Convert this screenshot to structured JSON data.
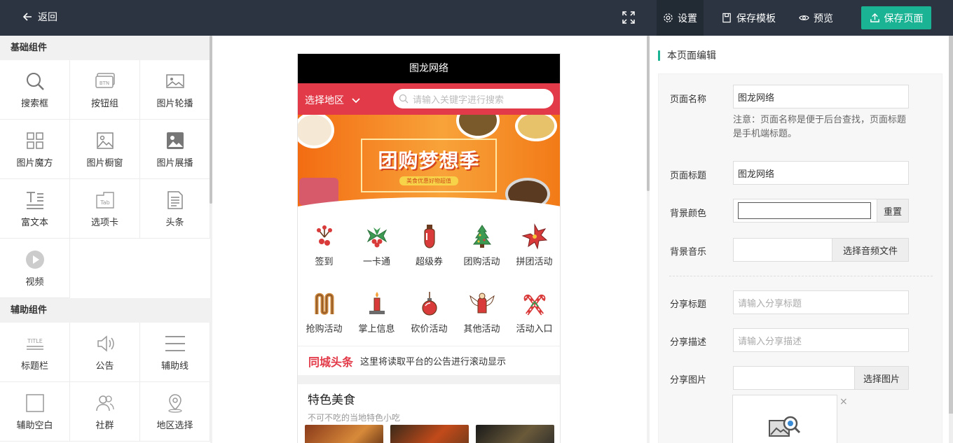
{
  "topbar": {
    "back_label": "返回",
    "settings_label": "设置",
    "save_template_label": "保存模板",
    "preview_label": "预览",
    "save_page_label": "保存页面"
  },
  "left": {
    "basic_title": "基础组件",
    "basic_items": [
      "搜索框",
      "按钮组",
      "图片轮播",
      "图片魔方",
      "图片橱窗",
      "图片展播",
      "富文本",
      "选项卡",
      "头条",
      "视频"
    ],
    "aux_title": "辅助组件",
    "aux_items": [
      "标题栏",
      "公告",
      "辅助线",
      "辅助空白",
      "社群",
      "地区选择"
    ]
  },
  "phone": {
    "title": "图龙网络",
    "region_label": "选择地区",
    "search_placeholder": "请输入关键字进行搜索",
    "banner_title": "团购梦想季",
    "banner_sub": "美食优惠好物超值",
    "icons": [
      "签到",
      "一卡通",
      "超级券",
      "团购活动",
      "拼团活动",
      "抢购活动",
      "掌上信息",
      "砍价活动",
      "其他活动",
      "活动入口"
    ],
    "notice_brand": "同城头条",
    "notice_text": "这里将读取平台的公告进行滚动显示",
    "food_title": "特色美食",
    "food_sub": "不可不吃的当地特色小吃"
  },
  "right": {
    "panel_title": "本页面编辑",
    "page_name_label": "页面名称",
    "page_name_value": "图龙网络",
    "page_name_note": "注意：页面名称是便于后台查找，页面标题是手机端标题。",
    "page_title_label": "页面标题",
    "page_title_value": "图龙网络",
    "bg_color_label": "背景颜色",
    "reset_label": "重置",
    "bg_music_label": "背景音乐",
    "choose_audio_label": "选择音频文件",
    "share_title_label": "分享标题",
    "share_title_placeholder": "请输入分享标题",
    "share_desc_label": "分享描述",
    "share_desc_placeholder": "请输入分享描述",
    "share_image_label": "分享图片",
    "choose_image_label": "选择图片",
    "close_glyph": "×"
  },
  "colors": {
    "accent": "#1ab394",
    "topbar": "#2b3440",
    "brand_red": "#e23a48"
  }
}
